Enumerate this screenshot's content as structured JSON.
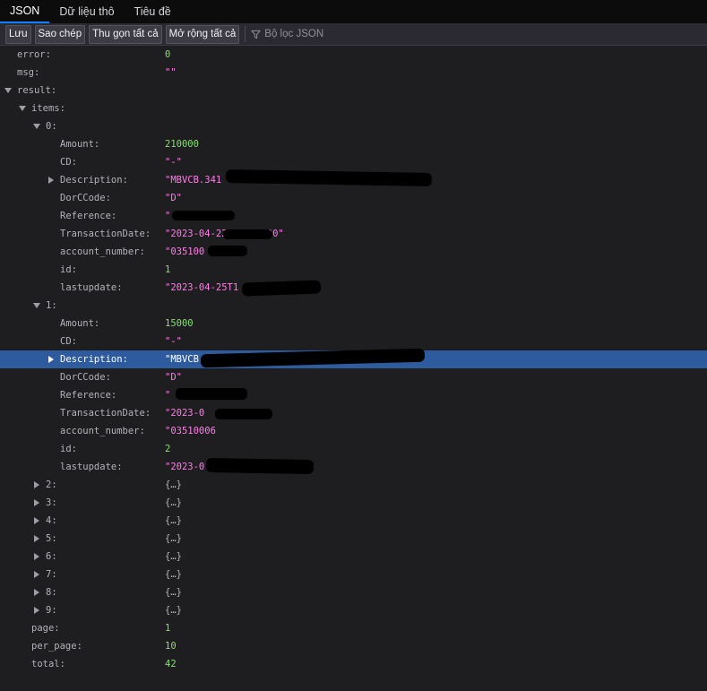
{
  "tabs": [
    "JSON",
    "Dữ liệu thô",
    "Tiêu đề"
  ],
  "toolbar": {
    "save": "Lưu",
    "copy": "Sao chép",
    "collapse_all": "Thu gọn tất cả",
    "expand_all": "Mở rộng tất cả",
    "filter_placeholder": "Bộ lọc JSON"
  },
  "rows": [
    {
      "depth": 0,
      "key": "error",
      "value": "0",
      "type": "num"
    },
    {
      "depth": 0,
      "key": "msg",
      "value": "\"\"",
      "type": "str"
    },
    {
      "depth": 0,
      "key": "result",
      "value": "",
      "type": "none",
      "twisty": "open"
    },
    {
      "depth": 1,
      "key": "items",
      "value": "",
      "type": "none",
      "twisty": "open"
    },
    {
      "depth": 2,
      "key": "0",
      "value": "",
      "type": "none",
      "twisty": "open"
    },
    {
      "depth": 3,
      "key": "Amount",
      "value": "210000",
      "type": "num"
    },
    {
      "depth": 3,
      "key": "CD",
      "value": "\"-\"",
      "type": "str"
    },
    {
      "depth": 3,
      "key": "Description",
      "value": "\"MBVCB.341",
      "type": "str",
      "twisty": "closed"
    },
    {
      "depth": 3,
      "key": "DorCCode",
      "value": "\"D\"",
      "type": "str"
    },
    {
      "depth": 3,
      "key": "Reference",
      "value": "\"",
      "type": "str"
    },
    {
      "depth": 3,
      "key": "TransactionDate",
      "value": "\"2023-04-22 00:00:00\"",
      "type": "str"
    },
    {
      "depth": 3,
      "key": "account_number",
      "value": "\"035100",
      "type": "str"
    },
    {
      "depth": 3,
      "key": "id",
      "value": "1",
      "type": "num"
    },
    {
      "depth": 3,
      "key": "lastupdate",
      "value": "\"2023-04-25T1",
      "type": "str"
    },
    {
      "depth": 2,
      "key": "1",
      "value": "",
      "type": "none",
      "twisty": "open"
    },
    {
      "depth": 3,
      "key": "Amount",
      "value": "15000",
      "type": "num"
    },
    {
      "depth": 3,
      "key": "CD",
      "value": "\"-\"",
      "type": "str"
    },
    {
      "depth": 3,
      "key": "Description",
      "value": "\"MBVCB.",
      "type": "str",
      "twisty": "closed",
      "selected": true
    },
    {
      "depth": 3,
      "key": "DorCCode",
      "value": "\"D\"",
      "type": "str"
    },
    {
      "depth": 3,
      "key": "Reference",
      "value": "\"",
      "type": "str"
    },
    {
      "depth": 3,
      "key": "TransactionDate",
      "value": "\"2023-0",
      "type": "str"
    },
    {
      "depth": 3,
      "key": "account_number",
      "value": "\"03510006",
      "type": "str"
    },
    {
      "depth": 3,
      "key": "id",
      "value": "2",
      "type": "num"
    },
    {
      "depth": 3,
      "key": "lastupdate",
      "value": "\"2023-0",
      "type": "str"
    },
    {
      "depth": 2,
      "key": "2",
      "value": "{…}",
      "type": "obj",
      "twisty": "closed"
    },
    {
      "depth": 2,
      "key": "3",
      "value": "{…}",
      "type": "obj",
      "twisty": "closed"
    },
    {
      "depth": 2,
      "key": "4",
      "value": "{…}",
      "type": "obj",
      "twisty": "closed"
    },
    {
      "depth": 2,
      "key": "5",
      "value": "{…}",
      "type": "obj",
      "twisty": "closed"
    },
    {
      "depth": 2,
      "key": "6",
      "value": "{…}",
      "type": "obj",
      "twisty": "closed"
    },
    {
      "depth": 2,
      "key": "7",
      "value": "{…}",
      "type": "obj",
      "twisty": "closed"
    },
    {
      "depth": 2,
      "key": "8",
      "value": "{…}",
      "type": "obj",
      "twisty": "closed"
    },
    {
      "depth": 2,
      "key": "9",
      "value": "{…}",
      "type": "obj",
      "twisty": "closed"
    },
    {
      "depth": 1,
      "key": "page",
      "value": "1",
      "type": "num"
    },
    {
      "depth": 1,
      "key": "per_page",
      "value": "10",
      "type": "num"
    },
    {
      "depth": 1,
      "key": "total",
      "value": "42",
      "type": "num"
    }
  ],
  "colors": {
    "background": "#1e1e20",
    "number": "#86de74",
    "string": "#ff7de9",
    "selection": "#2e5b9e",
    "tab_accent": "#0a84ff"
  }
}
